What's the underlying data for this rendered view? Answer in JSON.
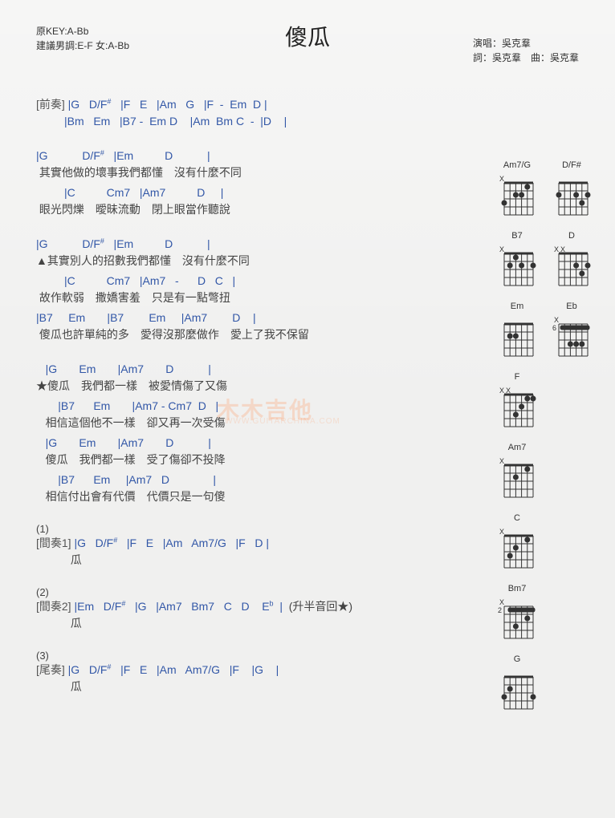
{
  "header": {
    "keyLine": "原KEY:A-Bb",
    "suggestLine": "建議男調:E-F 女:A-Bb",
    "performer": "演唱：吳克羣",
    "credits": "詞：吳克羣　曲：吳克羣"
  },
  "title": "傻瓜",
  "watermark": "木木吉他",
  "watermarkSub": "WWW.GUITARCHINA.COM",
  "intro": {
    "label": "[前奏]",
    "line1": "|G   D/F#   |F   E   |Am   G   |F  -  Em  D |",
    "line2": "|Bm   Em   |B7 -  Em D    |Am  Bm C  -  |D    |"
  },
  "verse1": [
    {
      "chords": "|G          D/F#   |Em         D           |",
      "lyrics": " 其實他做的壞事我們都懂　沒有什麼不同"
    },
    {
      "chords": "         |C         Cm7   |Am7         D     |",
      "lyrics": " 眼光閃爍　曖昧流動　閉上眼當作聽說"
    }
  ],
  "verse2": [
    {
      "chords": "|G          D/F#   |Em         D           |",
      "lyrics": "▲其實別人的招數我們都懂　沒有什麼不同"
    },
    {
      "chords": "         |C         Cm7   |Am7   -     D   C   |",
      "lyrics": " 故作軟弱　撒嬌害羞　只是有一點彆扭"
    },
    {
      "chords": "|B7     Em       |B7        Em     |Am7        D    |",
      "lyrics": " 傻瓜也許單純的多　愛得沒那麼做作　愛上了我不保留"
    }
  ],
  "chorus": [
    {
      "chords": "   |G       Em       |Am7       D           |",
      "lyrics": "★傻瓜　我們都一樣　被愛情傷了又傷"
    },
    {
      "chords": "       |B7      Em       |Am7 - Cm7  D   |",
      "lyrics": "   相信這個他不一樣　卻又再一次受傷"
    },
    {
      "chords": "   |G       Em       |Am7       D           |",
      "lyrics": "   傻瓜　我們都一樣　受了傷卻不投降"
    },
    {
      "chords": "       |B7      Em     |Am7   D              |",
      "lyrics": "   相信付出會有代價　代價只是一句傻"
    }
  ],
  "outro1": {
    "num": "(1)",
    "label": "[間奏1]",
    "chords": "|G   D/F#   |F   E   |Am   Am7/G   |F   D |",
    "lyric": "瓜"
  },
  "outro2": {
    "num": "(2)",
    "label": "[間奏2]",
    "chords": "|Em   D/F#   |G   |Am7   Bm7   C   D   Eb  |",
    "note": "(升半音回★)",
    "lyric": "瓜"
  },
  "outro3": {
    "num": "(3)",
    "label": "[尾奏]",
    "chords": "|G   D/F#   |F   E   |Am   Am7/G   |F    |G    |",
    "lyric": "瓜"
  },
  "diagrams": [
    [
      "Am7/G",
      "D/F#"
    ],
    [
      "B7",
      "D"
    ],
    [
      "Em",
      "Eb"
    ],
    [
      "F"
    ],
    [
      "Am7"
    ],
    [
      "C"
    ],
    [
      "Bm7"
    ],
    [
      "G"
    ]
  ]
}
